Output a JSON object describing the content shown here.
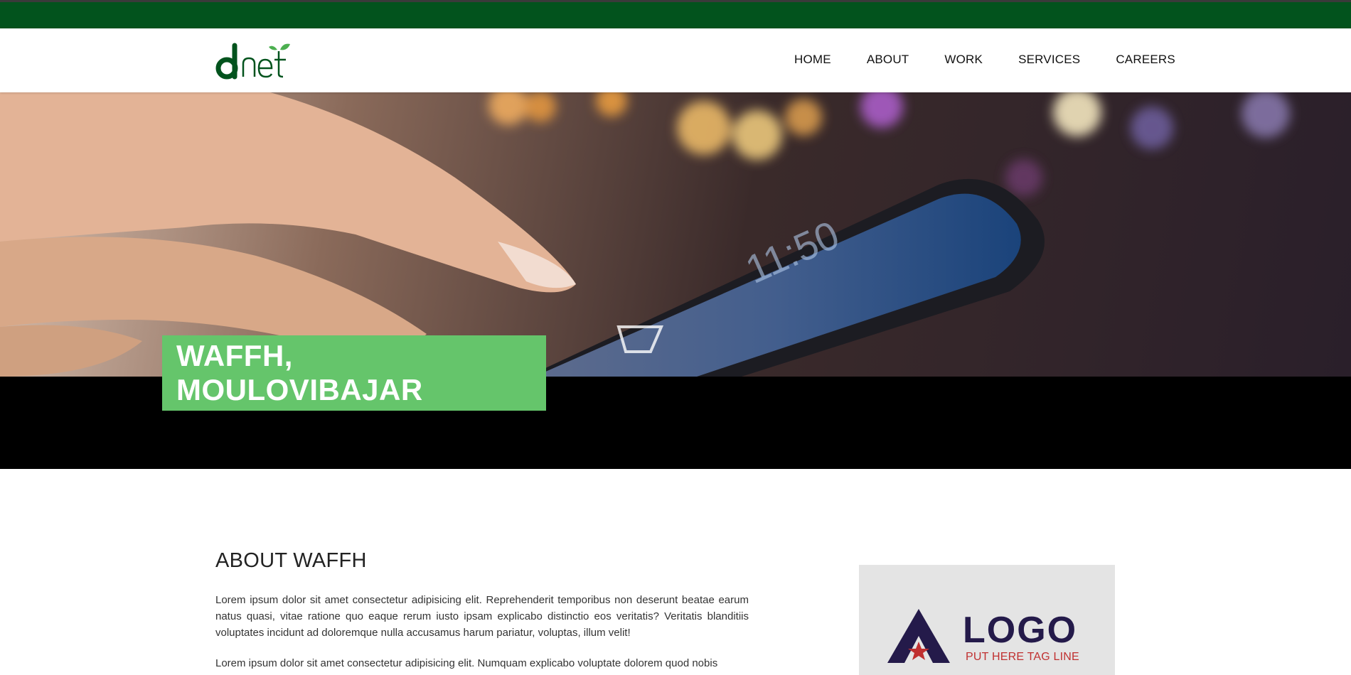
{
  "brand": {
    "logo_text": "dnet",
    "colors": {
      "primary": "#02531d",
      "accent": "#65c56b"
    }
  },
  "nav": {
    "items": [
      "HOME",
      "ABOUT",
      "WORK",
      "SERVICES",
      "CAREERS"
    ]
  },
  "hero": {
    "title": "WAFFH, MOULOVIBAJAR",
    "image": "hand-tapping-smartphone-photo"
  },
  "about": {
    "title": "ABOUT WAFFH",
    "paragraphs": [
      "Lorem ipsum dolor sit amet consectetur adipisicing elit. Reprehenderit temporibus non deserunt beatae earum natus quasi, vitae ratione quo eaque rerum iusto ipsam explicabo distinctio eos veritatis? Veritatis blanditiis voluptates incidunt ad doloremque nulla accusamus harum pariatur, voluptas, illum velit!",
      "Lorem ipsum dolor sit amet consectetur adipisicing elit. Numquam explicabo voluptate dolorem quod nobis"
    ]
  },
  "client_logo": {
    "word": "LOGO",
    "tagline": "PUT HERE TAG LINE",
    "icon": "triangle-star-icon"
  }
}
